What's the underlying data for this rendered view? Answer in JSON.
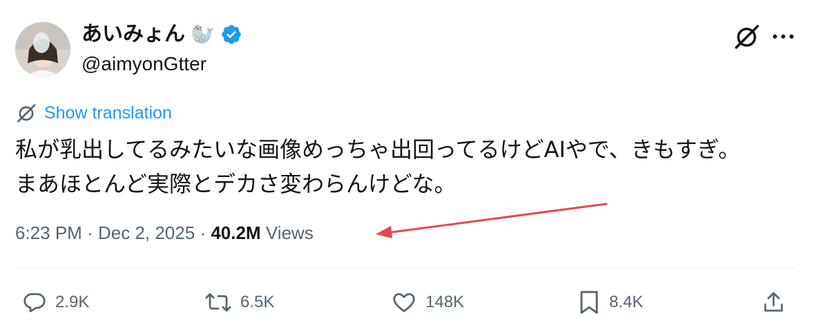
{
  "author": {
    "display_name": "あいみょん",
    "name_emoji": "🦭",
    "verified_icon": "verified-badge-icon",
    "handle": "@aimyonGtter"
  },
  "header_actions": {
    "grok_icon": "grok-icon",
    "more_icon": "more-options-icon"
  },
  "translation": {
    "icon": "grok-icon",
    "label": "Show translation"
  },
  "text": {
    "line1": "私が乳出してるみたいな画像めっちゃ出回ってるけどAIやで、きもすぎ。",
    "line2": "まあほとんど実際とデカさ変わらんけどな。"
  },
  "meta": {
    "time": "6:23 PM",
    "separator": "·",
    "date": "Dec 2, 2025",
    "views_count": "40.2M",
    "views_label": "Views"
  },
  "annotation": {
    "arrow_color": "#e5484d"
  },
  "actions": {
    "replies": "2.9K",
    "reposts": "6.5K",
    "likes": "148K",
    "bookmarks": "8.4K",
    "share_icon": "share-icon"
  },
  "colors": {
    "link_blue": "#1d9bf0",
    "secondary_text": "#536471",
    "primary_text": "#0f1419",
    "verified_blue": "#1d9bf0"
  }
}
